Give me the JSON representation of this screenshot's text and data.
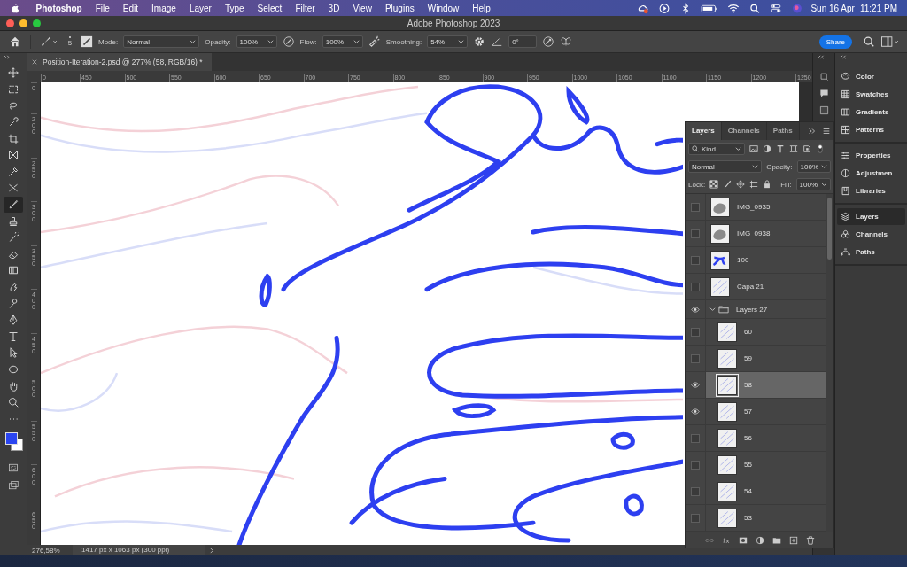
{
  "menu_bar": {
    "app": "Photoshop",
    "items": [
      "File",
      "Edit",
      "Image",
      "Layer",
      "Type",
      "Select",
      "Filter",
      "3D",
      "View",
      "Plugins",
      "Window",
      "Help"
    ],
    "date": "Sun 16 Apr",
    "time": "11:21 PM"
  },
  "window": {
    "title": "Adobe Photoshop 2023"
  },
  "options_bar": {
    "brush_size": "5",
    "mode_label": "Mode:",
    "mode": "Normal",
    "opacity_label": "Opacity:",
    "opacity": "100%",
    "flow_label": "Flow:",
    "flow": "100%",
    "smoothing_label": "Smoothing:",
    "smoothing": "54%",
    "angle": "0°",
    "share": "Share"
  },
  "document_tab": {
    "title": "Position-Iteration-2.psd @ 277% (58, RGB/16) *"
  },
  "rulers": {
    "horizontal": [
      "0",
      "450",
      "500",
      "550",
      "600",
      "650",
      "700",
      "750",
      "800",
      "850",
      "900",
      "950",
      "1000",
      "1050",
      "1100",
      "1150",
      "1200",
      "1250"
    ],
    "vertical": [
      "0",
      "200",
      "250",
      "300",
      "350",
      "400",
      "450",
      "500",
      "550",
      "600",
      "650"
    ]
  },
  "tools": [
    {
      "kind": "move",
      "selected": false
    },
    {
      "kind": "marquee",
      "selected": false
    },
    {
      "kind": "lasso",
      "selected": false
    },
    {
      "kind": "quick",
      "selected": false
    },
    {
      "kind": "crop",
      "selected": false
    },
    {
      "kind": "frame",
      "selected": false
    },
    {
      "kind": "eyedropper",
      "selected": false
    },
    {
      "kind": "healing",
      "selected": false
    },
    {
      "kind": "brush",
      "selected": true
    },
    {
      "kind": "stamp",
      "selected": false
    },
    {
      "kind": "history",
      "selected": false
    },
    {
      "kind": "eraser",
      "selected": false
    },
    {
      "kind": "gradient",
      "selected": false
    },
    {
      "kind": "smudge",
      "selected": false
    },
    {
      "kind": "dodge",
      "selected": false
    },
    {
      "kind": "pen",
      "selected": false
    },
    {
      "kind": "type",
      "selected": false
    },
    {
      "kind": "pathsel",
      "selected": false
    },
    {
      "kind": "ellipse",
      "selected": false
    },
    {
      "kind": "hand",
      "selected": false
    },
    {
      "kind": "zoom",
      "selected": false
    },
    {
      "kind": "more",
      "selected": false
    }
  ],
  "layers_panel": {
    "tabs": [
      {
        "label": "Layers",
        "selected": true
      },
      {
        "label": "Channels",
        "selected": false
      },
      {
        "label": "Paths",
        "selected": false
      }
    ],
    "filter": "Kind",
    "blend_mode": "Normal",
    "opacity_label": "Opacity:",
    "opacity": "100%",
    "lock_label": "Lock:",
    "fill_label": "Fill:",
    "fill": "100%",
    "layers": [
      {
        "name": "IMG_0935",
        "kind": "photo",
        "visible": false,
        "selected": false
      },
      {
        "name": "IMG_0938",
        "kind": "photo",
        "visible": false,
        "selected": false
      },
      {
        "name": "100",
        "kind": "ink",
        "visible": false,
        "selected": false
      },
      {
        "name": "Capa 21",
        "kind": "sketch",
        "visible": false,
        "selected": false
      },
      {
        "name": "Layers 27",
        "kind": "group",
        "visible": true,
        "selected": false,
        "expanded": true,
        "children": [
          {
            "name": "60",
            "kind": "sketch",
            "visible": false,
            "selected": false
          },
          {
            "name": "59",
            "kind": "sketch",
            "visible": false,
            "selected": false
          },
          {
            "name": "58",
            "kind": "sketch",
            "visible": true,
            "selected": true
          },
          {
            "name": "57",
            "kind": "sketch",
            "visible": true,
            "selected": false
          },
          {
            "name": "56",
            "kind": "sketch",
            "visible": false,
            "selected": false
          },
          {
            "name": "55",
            "kind": "sketch",
            "visible": false,
            "selected": false
          },
          {
            "name": "54",
            "kind": "sketch",
            "visible": false,
            "selected": false
          },
          {
            "name": "53",
            "kind": "sketch",
            "visible": false,
            "selected": false
          }
        ]
      }
    ]
  },
  "side_panel": {
    "groups": [
      [
        {
          "label": "Color",
          "kind": "color",
          "selected": false
        },
        {
          "label": "Swatches",
          "kind": "swatches",
          "selected": false
        },
        {
          "label": "Gradients",
          "kind": "gradients",
          "selected": false
        },
        {
          "label": "Patterns",
          "kind": "patterns",
          "selected": false
        }
      ],
      [
        {
          "label": "Properties",
          "kind": "properties",
          "selected": false
        },
        {
          "label": "Adjustmen…",
          "kind": "adjustments",
          "selected": false
        },
        {
          "label": "Libraries",
          "kind": "libraries",
          "selected": false
        }
      ],
      [
        {
          "label": "Layers",
          "kind": "layers",
          "selected": true
        },
        {
          "label": "Channels",
          "kind": "channels",
          "selected": false
        },
        {
          "label": "Paths",
          "kind": "paths",
          "selected": false
        }
      ]
    ]
  },
  "status_bar": {
    "zoom": "276,58%",
    "info": "1417 px x 1063 px (300 ppi)"
  }
}
